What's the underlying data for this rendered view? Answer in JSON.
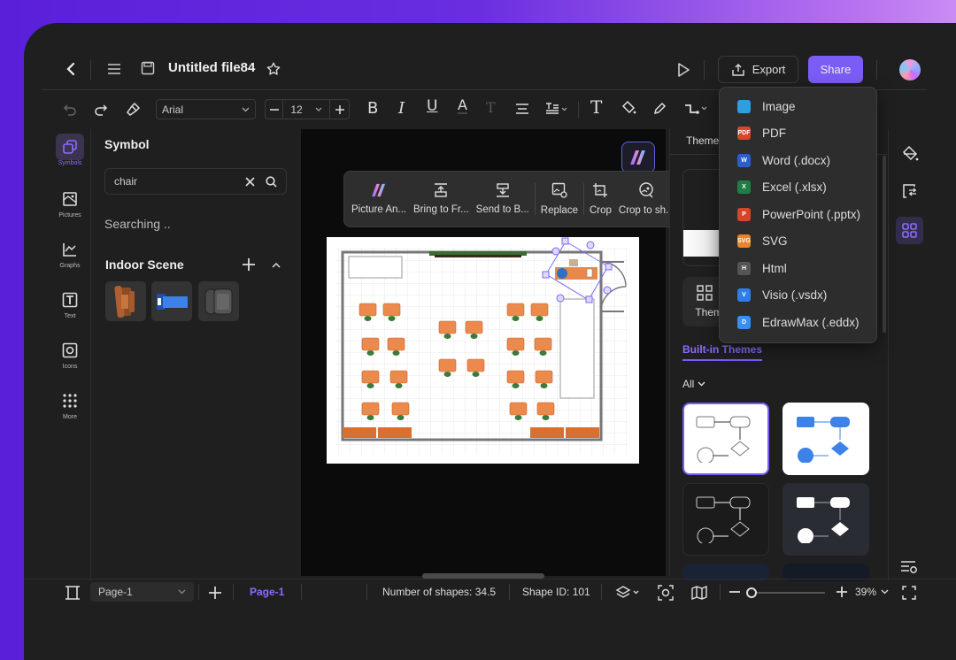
{
  "header": {
    "title": "Untitled file84",
    "export_label": "Export",
    "share_label": "Share"
  },
  "toolbar": {
    "font_family": "Arial",
    "font_size": "12"
  },
  "left_rail": {
    "items": [
      {
        "label": "Symbols",
        "icon": "symbols-icon",
        "active": true
      },
      {
        "label": "Pictures",
        "icon": "pictures-icon"
      },
      {
        "label": "Graphs",
        "icon": "graphs-icon"
      },
      {
        "label": "Text",
        "icon": "text-icon"
      },
      {
        "label": "Icons",
        "icon": "icons-icon"
      },
      {
        "label": "More",
        "icon": "more-icon"
      }
    ]
  },
  "symbol_panel": {
    "title": "Symbol",
    "search_value": "chair",
    "status": "Searching ..",
    "section_title": "Indoor Scene",
    "symbols": [
      "brown-armchair",
      "blue-lounge-chair",
      "gray-armchair"
    ]
  },
  "image_toolbar": {
    "items": [
      {
        "label": "Picture An...",
        "icon": "picture-ai-icon"
      },
      {
        "label": "Bring to Fr...",
        "icon": "bring-to-front-icon"
      },
      {
        "label": "Send to B...",
        "icon": "send-to-back-icon"
      },
      {
        "label": "Replace",
        "icon": "replace-image-icon"
      },
      {
        "label": "Crop",
        "icon": "crop-icon"
      },
      {
        "label": "Crop to sh...",
        "icon": "crop-to-shape-icon"
      }
    ]
  },
  "export_menu": {
    "items": [
      {
        "label": "Image",
        "badge": "",
        "color": "#2ea0e0"
      },
      {
        "label": "PDF",
        "badge": "PDF",
        "color": "#d9462b"
      },
      {
        "label": "Word (.docx)",
        "badge": "W",
        "color": "#2b5fc9"
      },
      {
        "label": "Excel (.xlsx)",
        "badge": "X",
        "color": "#1e7e45"
      },
      {
        "label": "PowerPoint (.pptx)",
        "badge": "P",
        "color": "#d6452a"
      },
      {
        "label": "SVG",
        "badge": "SVG",
        "color": "#e8862a"
      },
      {
        "label": "Html",
        "badge": "H",
        "color": "#555555"
      },
      {
        "label": "Visio (.vsdx)",
        "badge": "V",
        "color": "#2f7de8"
      },
      {
        "label": "EdrawMax (.eddx)",
        "badge": "D",
        "color": "#3a8ef0"
      }
    ]
  },
  "theme_panel": {
    "tab_label": "Theme",
    "theme_button": "Theme",
    "section_title": "Built-in Themes",
    "filter": "All"
  },
  "status_bar": {
    "page_select": "Page-1",
    "page_tab": "Page-1",
    "shape_count": "Number of shapes: 34.5",
    "shape_id": "Shape ID: 101",
    "zoom": "39%",
    "zoom_fraction": 0.1
  },
  "colors": {
    "accent": "#7b5cf5",
    "background": "#1f1f1f",
    "canvas": "#0b0b0b"
  }
}
